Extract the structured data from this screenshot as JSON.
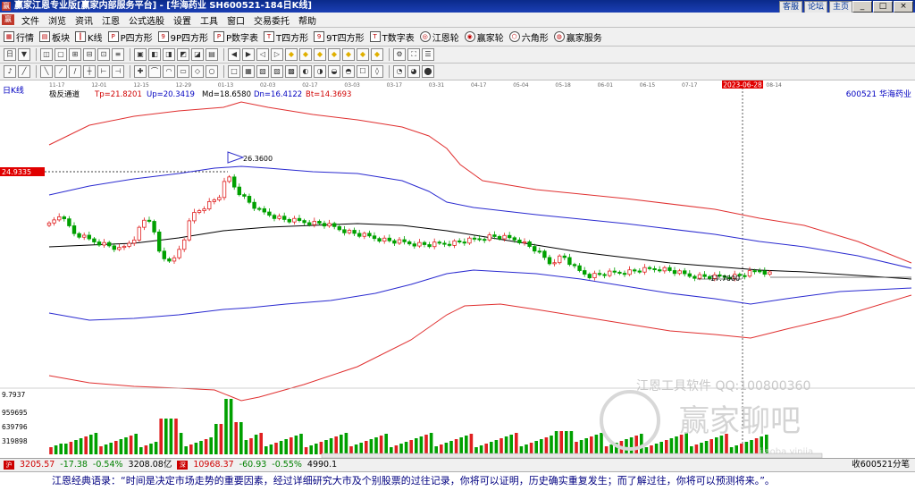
{
  "window": {
    "title": "赢家江恩专业版[赢家内部服务平台] - [华海药业  SH600521-184日K线]",
    "links": [
      "客服",
      "论坛",
      "主页"
    ],
    "buttons": [
      "_",
      "□",
      "×"
    ]
  },
  "menu": [
    "文件",
    "浏览",
    "资讯",
    "江恩",
    "公式选股",
    "设置",
    "工具",
    "窗口",
    "交易委托",
    "帮助"
  ],
  "toolbar1": [
    {
      "label": "行情",
      "icon": "grid-icon"
    },
    {
      "label": "板块",
      "icon": "blocks-icon"
    },
    {
      "label": "K线",
      "icon": "candle-icon"
    },
    {
      "label": "P四方形",
      "icon": "square-p-icon"
    },
    {
      "label": "9P四方形",
      "icon": "square-9p-icon"
    },
    {
      "label": "P数字表",
      "icon": "table-p-icon"
    },
    {
      "label": "T四方形",
      "icon": "square-t-icon"
    },
    {
      "label": "9T四方形",
      "icon": "square-9t-icon"
    },
    {
      "label": "T数字表",
      "icon": "table-t-icon"
    },
    {
      "label": "江恩轮",
      "icon": "gann-wheel-icon"
    },
    {
      "label": "赢家轮",
      "icon": "winner-wheel-icon"
    },
    {
      "label": "六角形",
      "icon": "hexagon-icon"
    },
    {
      "label": "赢家服务",
      "icon": "service-icon"
    }
  ],
  "chart": {
    "period": "日K线",
    "indicator": "极反通道",
    "params": [
      {
        "label": "Tp=21.8201",
        "color": "#d00000"
      },
      {
        "label": "Up=20.3419",
        "color": "#0000c0"
      },
      {
        "label": "Md=18.6580",
        "color": "#000000"
      },
      {
        "label": "Dn=16.4122",
        "color": "#0000c0"
      },
      {
        "label": "Bt=14.3693",
        "color": "#d00000"
      }
    ],
    "symbol": "600521  华海药业",
    "price_tag": "24.9335",
    "cursor_date": "2023-06-28",
    "annotations": [
      "26.3600",
      "17.7000"
    ],
    "dates": [
      "11-17",
      "12-01",
      "12-15",
      "12-29",
      "01-13",
      "02-03",
      "02-17",
      "03-03",
      "03-17",
      "03-31",
      "04-17",
      "05-04",
      "05-18",
      "06-01",
      "06-15",
      "07-17",
      "07-31",
      "08-14"
    ],
    "volume_labels": [
      "9.7937",
      "959695",
      "639796",
      "319898"
    ],
    "watermark_text": "江恩工具软件  QQ:100800360",
    "watermark_brand": "赢家聊吧",
    "watermark_url": "jiaoba.yinjia"
  },
  "status": {
    "sh_index": "3205.57",
    "sh_change": "-17.38",
    "sh_pct": "-0.54%",
    "sh_amount": "3208.08亿",
    "sz_index": "10968.37",
    "sz_change": "-60.93",
    "sz_pct": "-0.55%",
    "sz_amount": "4990.1",
    "right_text": "收600521分笔"
  },
  "quote": "江恩经典语录：“时间是决定市场走势的重要因素，经过详细研究大市及个别股票的过往记录，你将可以证明，历史确实重复发生；而了解过往，你将可以预测将来。”。",
  "colors": {
    "titlebar": "#0a2a8a",
    "red_line": "#e03030",
    "blue_line": "#2a2ad0",
    "mid_line": "#000000",
    "up_candle": "#e02020",
    "down_candle": "#00a000"
  }
}
